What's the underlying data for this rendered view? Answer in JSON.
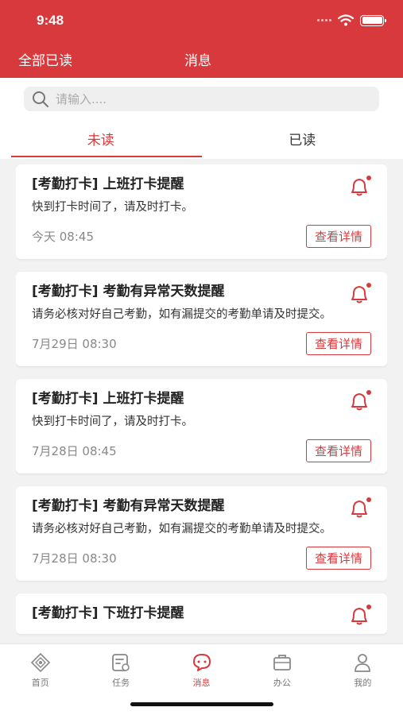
{
  "status_bar": {
    "time": "9:48"
  },
  "header": {
    "mark_all_read": "全部已读",
    "title": "消息"
  },
  "search": {
    "placeholder": "请输入...."
  },
  "tabs": [
    {
      "label": "未读"
    },
    {
      "label": "已读"
    }
  ],
  "messages": [
    {
      "title": "[考勤打卡] 上班打卡提醒",
      "body": "快到打卡时间了，请及时打卡。",
      "time": "今天 08:45",
      "button": "查看详情"
    },
    {
      "title": "[考勤打卡] 考勤有异常天数提醒",
      "body": "请务必核对好自己考勤，如有漏提交的考勤单请及时提交。",
      "time": "7月29日 08:30",
      "button": "查看详情"
    },
    {
      "title": "[考勤打卡] 上班打卡提醒",
      "body": "快到打卡时间了，请及时打卡。",
      "time": "7月28日 08:45",
      "button": "查看详情"
    },
    {
      "title": "[考勤打卡] 考勤有异常天数提醒",
      "body": "请务必核对好自己考勤，如有漏提交的考勤单请及时提交。",
      "time": "7月28日 08:30",
      "button": "查看详情"
    },
    {
      "title": "[考勤打卡] 下班打卡提醒",
      "body": "",
      "time": "",
      "button": ""
    }
  ],
  "tabbar": [
    {
      "label": "首页",
      "icon": "home-icon"
    },
    {
      "label": "任务",
      "icon": "task-icon"
    },
    {
      "label": "消息",
      "icon": "message-icon"
    },
    {
      "label": "办公",
      "icon": "briefcase-icon"
    },
    {
      "label": "我的",
      "icon": "user-icon"
    }
  ],
  "colors": {
    "brand": "#d8393d",
    "background": "#f2f2f2"
  }
}
